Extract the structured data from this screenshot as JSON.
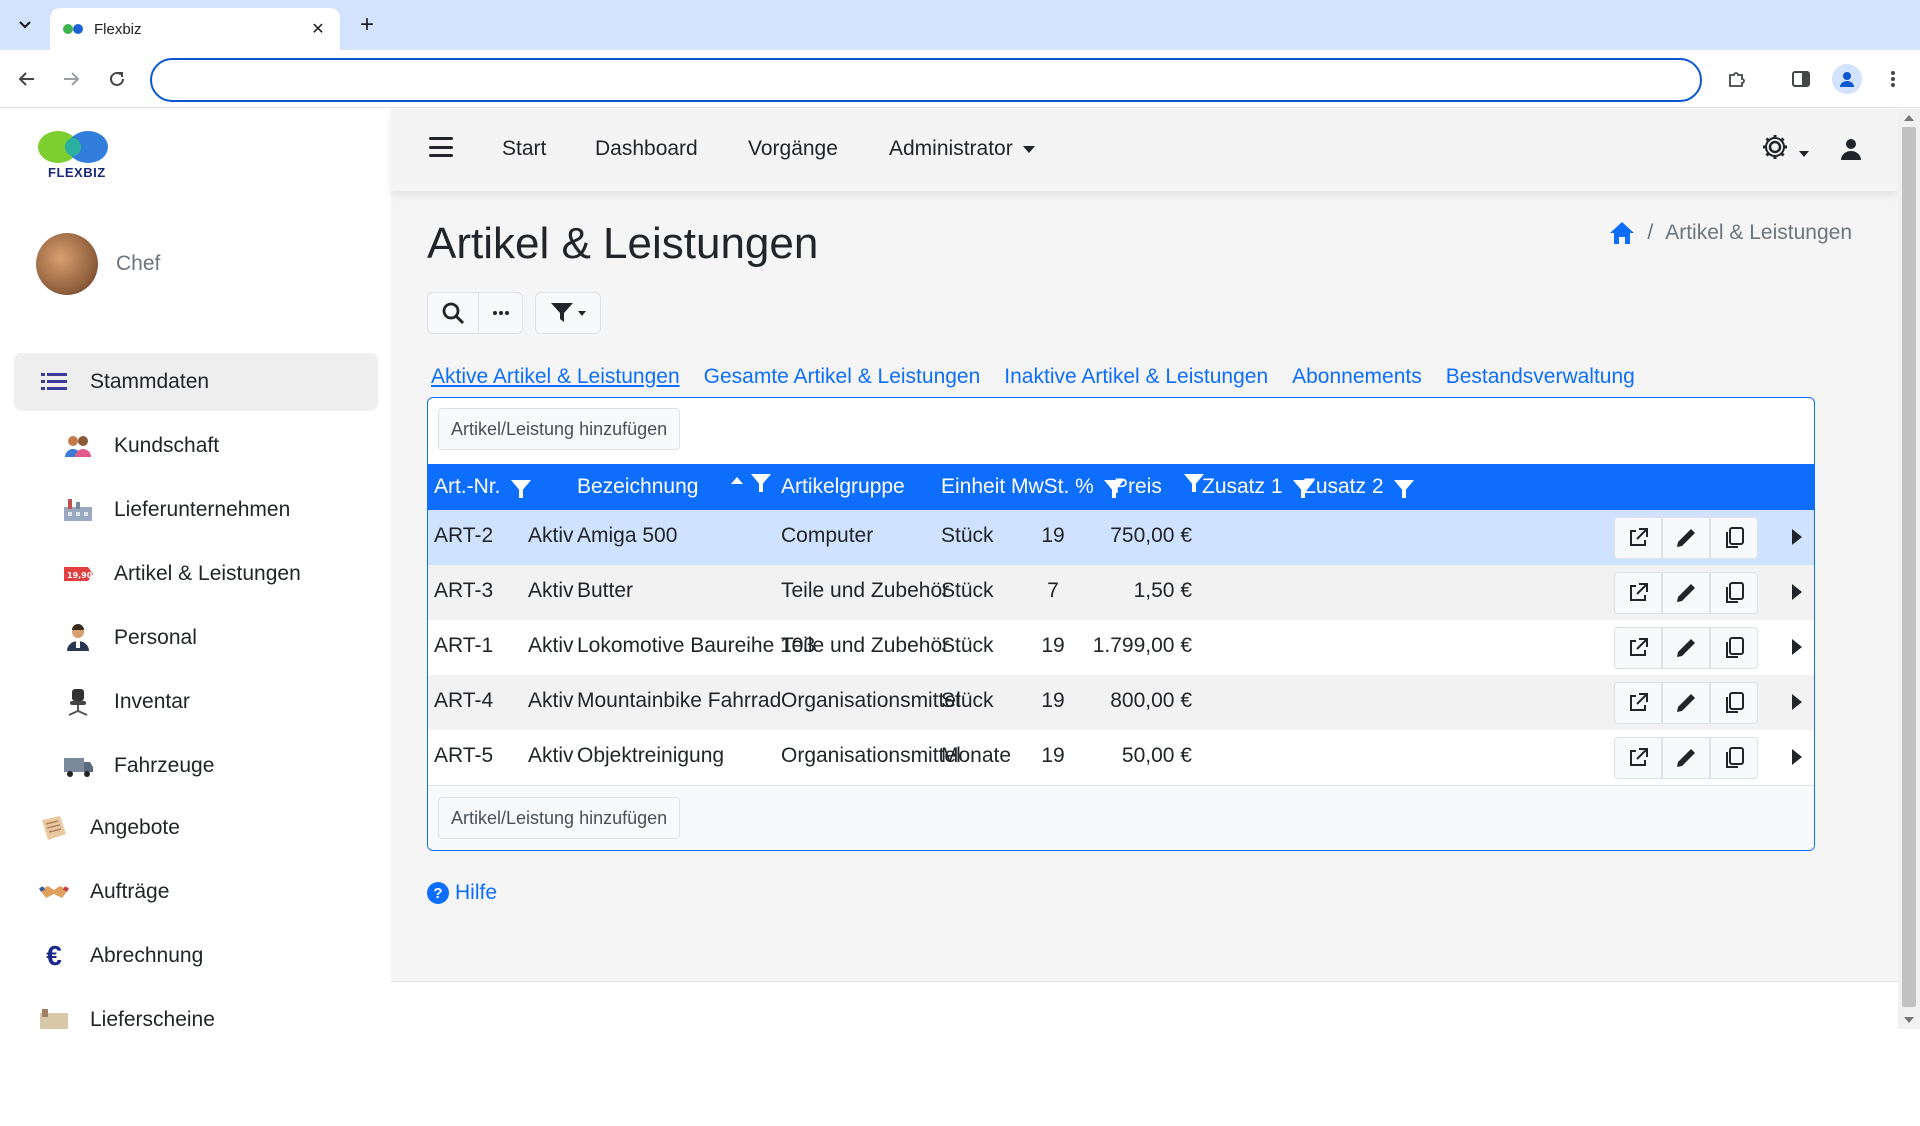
{
  "browser": {
    "tab_title": "Flexbiz",
    "address_value": ""
  },
  "sidebar": {
    "logo_text": "FLEXBIZ",
    "user_name": "Chef",
    "items": [
      {
        "label": "Stammdaten",
        "icon": "list-icon",
        "active": true
      },
      {
        "label": "Kundschaft",
        "icon": "customers-icon"
      },
      {
        "label": "Lieferunternehmen",
        "icon": "factory-icon"
      },
      {
        "label": "Artikel & Leistungen",
        "icon": "price-tag-icon"
      },
      {
        "label": "Personal",
        "icon": "person-icon"
      },
      {
        "label": "Inventar",
        "icon": "office-chair-icon"
      },
      {
        "label": "Fahrzeuge",
        "icon": "truck-icon"
      },
      {
        "label": "Angebote",
        "icon": "offer-icon"
      },
      {
        "label": "Aufträge",
        "icon": "handshake-icon"
      },
      {
        "label": "Abrechnung",
        "icon": "euro-icon"
      },
      {
        "label": "Lieferscheine",
        "icon": "delivery-note-icon"
      }
    ]
  },
  "topnav": {
    "links": [
      "Start",
      "Dashboard",
      "Vorgänge",
      "Administrator"
    ]
  },
  "page": {
    "title": "Artikel & Leistungen",
    "breadcrumb_current": "Artikel & Leistungen",
    "tabs": [
      "Aktive Artikel & Leistungen",
      "Gesamte Artikel & Leistungen",
      "Inaktive Artikel & Leistungen",
      "Abonnements",
      "Bestandsverwaltung"
    ],
    "active_tab": 0,
    "add_button": "Artikel/Leistung hinzufügen",
    "help": "Hilfe"
  },
  "table": {
    "columns": [
      "Art.-Nr.",
      "Bezeichnung",
      "Artikelgruppe",
      "Einheit",
      "MwSt. %",
      "Preis",
      "Zusatz 1",
      "Zusatz 2"
    ],
    "rows": [
      {
        "nr": "ART-2",
        "status": "Aktiv",
        "name": "Amiga 500",
        "group": "Computer",
        "unit": "Stück",
        "vat": "19",
        "price": "750,00 €"
      },
      {
        "nr": "ART-3",
        "status": "Aktiv",
        "name": "Butter",
        "group": "Teile und Zubehör",
        "unit": "Stück",
        "vat": "7",
        "price": "1,50 €"
      },
      {
        "nr": "ART-1",
        "status": "Aktiv",
        "name": "Lokomotive Baureihe 103",
        "group": "Teile und Zubehör",
        "unit": "Stück",
        "vat": "19",
        "price": "1.799,00 €"
      },
      {
        "nr": "ART-4",
        "status": "Aktiv",
        "name": "Mountainbike Fahrrad",
        "group": "Organisationsmittel",
        "unit": "Stück",
        "vat": "19",
        "price": "800,00 €"
      },
      {
        "nr": "ART-5",
        "status": "Aktiv",
        "name": "Objektreinigung",
        "group": "Organisationsmittel",
        "unit": "Monate",
        "vat": "19",
        "price": "50,00 €"
      }
    ]
  },
  "colors": {
    "primary": "#0d6efd",
    "selected_row": "#cfe2ff"
  }
}
